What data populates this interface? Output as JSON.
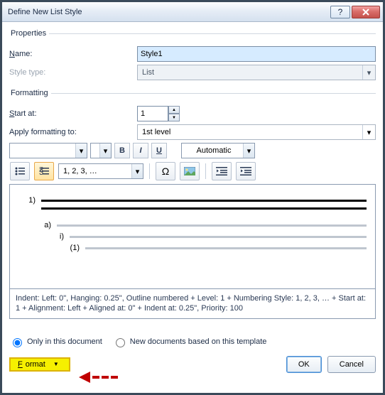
{
  "title": "Define New List Style",
  "properties": {
    "legend": "Properties",
    "name_label": "Name:",
    "name_value": "Style1",
    "type_label": "Style type:",
    "type_value": "List"
  },
  "formatting": {
    "legend": "Formatting",
    "start_label": "Start at:",
    "start_value": "1",
    "apply_label": "Apply formatting to:",
    "apply_value": "1st level",
    "bold": "B",
    "italic": "I",
    "underline": "U",
    "color_label": "Automatic",
    "numfmt": "1, 2, 3, …",
    "symbol": "Ω",
    "preview_labels": [
      "1)",
      "a)",
      "i)",
      "(1)"
    ],
    "description": "Indent: Left:  0\", Hanging:  0.25\", Outline numbered + Level: 1 + Numbering Style: 1, 2, 3, … + Start at: 1 + Alignment: Left + Aligned at:  0\" + Indent at:  0.25\", Priority: 100"
  },
  "radios": {
    "only": "Only in this document",
    "template": "New documents based on this template"
  },
  "buttons": {
    "format": "Format",
    "ok": "OK",
    "cancel": "Cancel"
  }
}
